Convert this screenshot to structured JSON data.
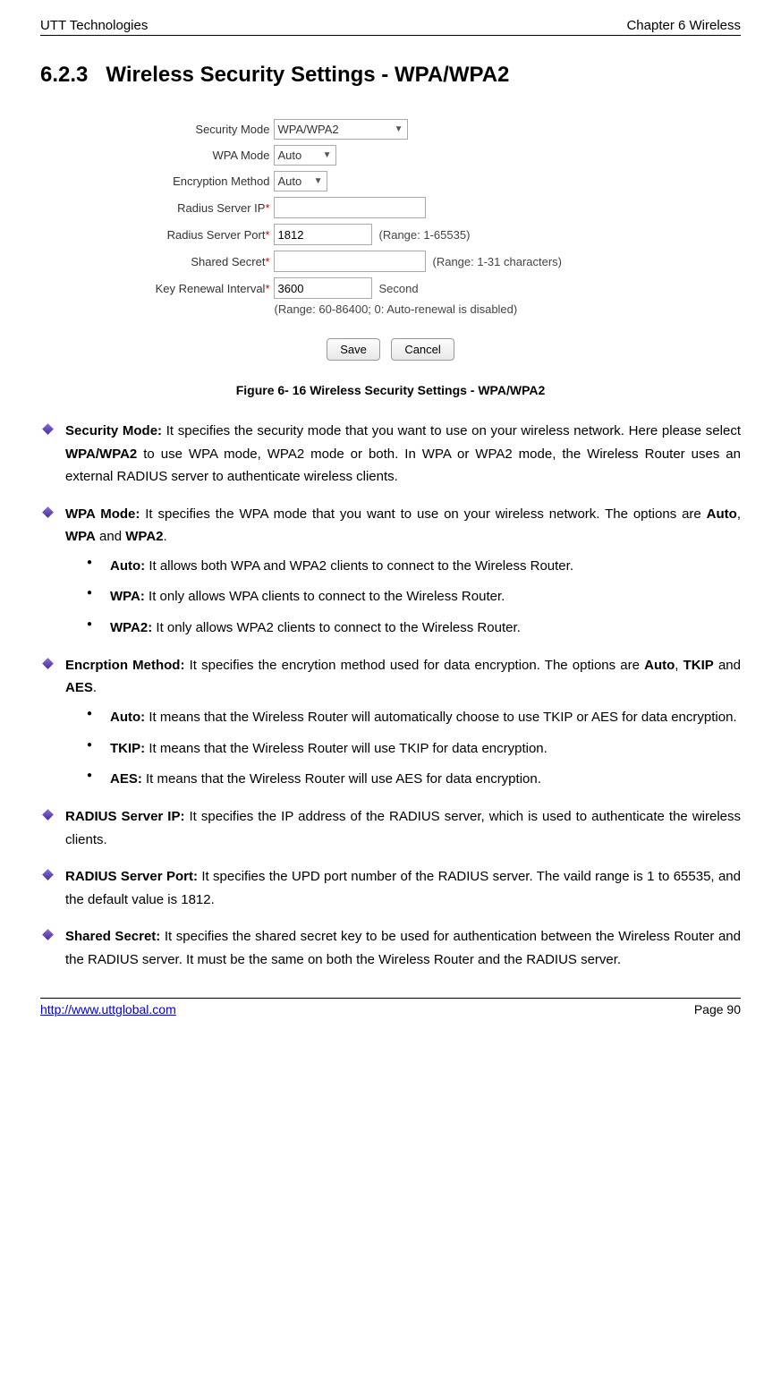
{
  "header": {
    "left": "UTT Technologies",
    "right": "Chapter 6 Wireless"
  },
  "section": {
    "num": "6.2.3",
    "title": "Wireless Security Settings - WPA/WPA2"
  },
  "form": {
    "security_mode": {
      "label": "Security Mode",
      "value": "WPA/WPA2"
    },
    "wpa_mode": {
      "label": "WPA Mode",
      "value": "Auto"
    },
    "enc_method": {
      "label": "Encryption Method",
      "value": "Auto"
    },
    "radius_ip": {
      "label": "Radius Server IP",
      "value": ""
    },
    "radius_port": {
      "label": "Radius Server Port",
      "value": "1812",
      "hint": "(Range: 1-65535)"
    },
    "shared_secret": {
      "label": "Shared Secret",
      "value": "",
      "hint": "(Range: 1-31 characters)"
    },
    "key_renew": {
      "label": "Key Renewal Interval",
      "value": "3600",
      "unit": "Second"
    },
    "range_line": "(Range: 60-86400; 0: Auto-renewal is disabled)",
    "save": "Save",
    "cancel": "Cancel"
  },
  "figure_caption": "Figure 6- 16 Wireless Security Settings - WPA/WPA2",
  "bullets": {
    "sec_mode_label": "Security Mode:",
    "sec_mode_text1": " It specifies the security mode that you want to use on your wireless network. Here please select ",
    "sec_mode_bold": "WPA/WPA2",
    "sec_mode_text2": " to use WPA mode, WPA2 mode or both. In WPA or WPA2 mode, the Wireless Router uses an external RADIUS server to authenticate wireless clients.",
    "wpa_label": "WPA Mode:",
    "wpa_text1": " It specifies the WPA mode that you want to use on your wireless network. The options are ",
    "wpa_b1": "Auto",
    "wpa_c1": ", ",
    "wpa_b2": "WPA",
    "wpa_c2": " and ",
    "wpa_b3": "WPA2",
    "wpa_c3": ".",
    "wpa_auto_label": "Auto:",
    "wpa_auto_text": " It allows both WPA and WPA2 clients to connect to the Wireless Router.",
    "wpa_wpa_label": "WPA:",
    "wpa_wpa_text": " It only allows WPA clients to connect to the Wireless Router.",
    "wpa_wpa2_label": "WPA2:",
    "wpa_wpa2_text": " It only allows WPA2 clients to connect to the Wireless Router.",
    "enc_label": "Encrption Method:",
    "enc_text1": " It specifies the encrytion method used for data encryption. The options are ",
    "enc_b1": "Auto",
    "enc_c1": ", ",
    "enc_b2": "TKIP",
    "enc_c2": " and ",
    "enc_b3": "AES",
    "enc_c3": ".",
    "enc_auto_label": "Auto:",
    "enc_auto_text": " It means that the Wireless Router will automatically choose to use TKIP or AES for data encryption.",
    "enc_tkip_label": "TKIP:",
    "enc_tkip_text": " It means that the Wireless Router will use TKIP for data encryption.",
    "enc_aes_label": "AES:",
    "enc_aes_text": " It means that the Wireless Router will use AES for data encryption.",
    "rip_label": "RADIUS Server IP:",
    "rip_text": " It specifies the IP address of the RADIUS server, which is used to authenticate the wireless clients.",
    "rport_label": "RADIUS Server Port:",
    "rport_text": " It specifies the UPD port number of the RADIUS server. The vaild range is 1 to 65535, and the default value is 1812.",
    "ss_label": "Shared Secret:",
    "ss_text": " It specifies the shared secret key to be used for authentication between the Wireless Router and the RADIUS server. It must be the same on both the Wireless Router and the RADIUS server."
  },
  "footer": {
    "link": "http://www.uttglobal.com",
    "page": "Page 90"
  }
}
